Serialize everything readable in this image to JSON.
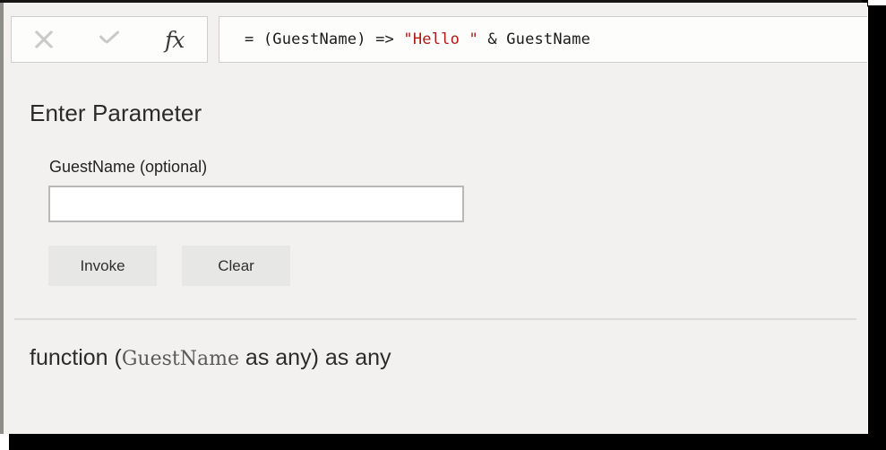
{
  "formula_bar": {
    "cancel_icon": "close-x-icon",
    "accept_icon": "checkmark-icon",
    "function_icon_label": "fx",
    "formula_prefix": "= (GuestName) => ",
    "formula_literal": "\"Hello \"",
    "formula_suffix": " & GuestName",
    "formula_full": "= (GuestName) => \"Hello \" & GuestName"
  },
  "panel": {
    "title": "Enter Parameter",
    "param_label": "GuestName (optional)",
    "param_value": "",
    "param_placeholder": "",
    "invoke_label": "Invoke",
    "clear_label": "Clear"
  },
  "signature": {
    "keyword": "function (",
    "param_name": "GuestName",
    "param_type": " as any) as any",
    "full_text": "function (GuestName as any) as any"
  },
  "colors": {
    "dialog_background": "#f2f1ef",
    "field_background": "#ffffff",
    "button_background": "#e7e7e6",
    "string_literal": "#b01818",
    "frame": "#000000",
    "divider": "#dcdbd8"
  }
}
